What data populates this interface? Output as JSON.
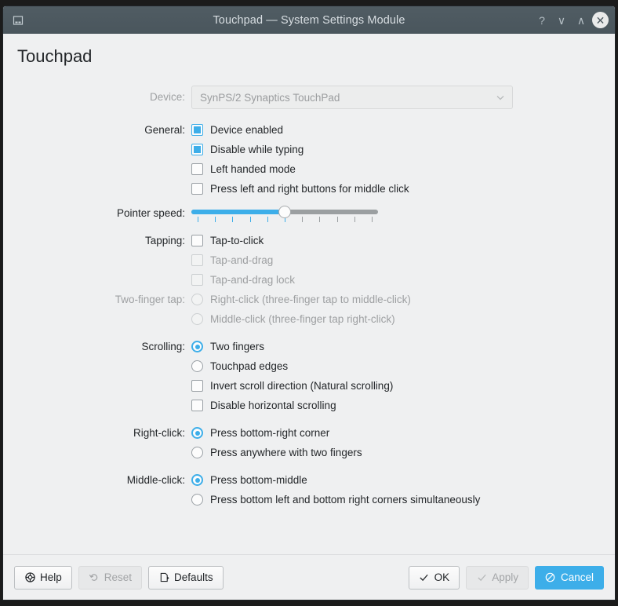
{
  "window": {
    "title": "Touchpad — System Settings Module",
    "icon": "touchpad-icon",
    "buttons": {
      "help": "?",
      "minimize": "∨",
      "maximize": "∧",
      "close": "✕"
    }
  },
  "page": {
    "heading": "Touchpad"
  },
  "device": {
    "label": "Device:",
    "value": "SynPS/2 Synaptics TouchPad",
    "enabled": false
  },
  "general": {
    "label": "General:",
    "options": [
      {
        "text": "Device enabled",
        "checked": true,
        "enabled": true
      },
      {
        "text": "Disable while typing",
        "checked": true,
        "enabled": true
      },
      {
        "text": "Left handed mode",
        "checked": false,
        "enabled": true
      },
      {
        "text": "Press left and right buttons for middle click",
        "checked": false,
        "enabled": true
      }
    ]
  },
  "pointer_speed": {
    "label": "Pointer speed:",
    "value": 5,
    "min": 0,
    "max": 10,
    "ticks": 11
  },
  "tapping": {
    "label": "Tapping:",
    "options": [
      {
        "text": "Tap-to-click",
        "checked": false,
        "enabled": true
      },
      {
        "text": "Tap-and-drag",
        "checked": false,
        "enabled": false
      },
      {
        "text": "Tap-and-drag lock",
        "checked": false,
        "enabled": false
      }
    ]
  },
  "two_finger_tap": {
    "label": "Two-finger tap:",
    "enabled": false,
    "options": [
      {
        "text": "Right-click (three-finger tap to middle-click)",
        "selected": false,
        "enabled": false
      },
      {
        "text": "Middle-click (three-finger tap right-click)",
        "selected": false,
        "enabled": false
      }
    ]
  },
  "scrolling": {
    "label": "Scrolling:",
    "radios": [
      {
        "text": "Two fingers",
        "selected": true,
        "enabled": true
      },
      {
        "text": "Touchpad edges",
        "selected": false,
        "enabled": true
      }
    ],
    "checks": [
      {
        "text": "Invert scroll direction (Natural scrolling)",
        "checked": false,
        "enabled": true
      },
      {
        "text": "Disable horizontal scrolling",
        "checked": false,
        "enabled": true
      }
    ]
  },
  "right_click": {
    "label": "Right-click:",
    "options": [
      {
        "text": "Press bottom-right corner",
        "selected": true,
        "enabled": true
      },
      {
        "text": "Press anywhere with two fingers",
        "selected": false,
        "enabled": true
      }
    ]
  },
  "middle_click": {
    "label": "Middle-click:",
    "options": [
      {
        "text": "Press bottom-middle",
        "selected": true,
        "enabled": true
      },
      {
        "text": "Press bottom left and bottom right corners simultaneously",
        "selected": false,
        "enabled": true
      }
    ]
  },
  "buttonbar": {
    "help": "Help",
    "reset": "Reset",
    "defaults": "Defaults",
    "ok": "OK",
    "apply": "Apply",
    "cancel": "Cancel"
  },
  "colors": {
    "accent": "#3daee9",
    "titlebar": "#4d5960",
    "window_bg": "#eff0f1",
    "text": "#232629",
    "disabled_text": "#9ea0a2"
  }
}
